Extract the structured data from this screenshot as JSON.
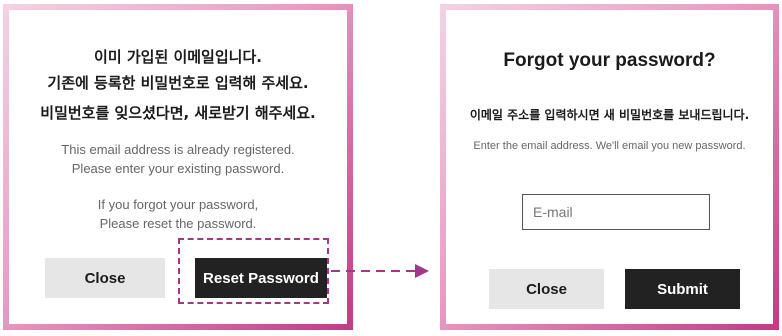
{
  "left_dialog": {
    "heading_line1": "이미 가입된 이메일입니다.",
    "heading_line2": "기존에 등록한 비밀번호로 입력해 주세요.",
    "heading_line3": "비밀번호를 잊으셨다면, 새로받기 해주세요.",
    "en_line1": "This email address is already registered.",
    "en_line2": "Please enter your existing password.",
    "en_line3": "If you forgot your password,",
    "en_line4": "Please reset the password.",
    "close_label": "Close",
    "reset_label": "Reset Password"
  },
  "right_dialog": {
    "title": "Forgot your password?",
    "ko_instruction": "이메일 주소를 입력하시면 새 비밀번호를 보내드립니다.",
    "en_instruction": "Enter the email address. We'll email you new password.",
    "email_placeholder": "E-mail",
    "email_value": "",
    "close_label": "Close",
    "submit_label": "Submit"
  },
  "colors": {
    "accent": "#a4368b",
    "dark_button": "#222222",
    "light_button": "#e6e6e6",
    "border_gradient_end": "#c23a86"
  }
}
